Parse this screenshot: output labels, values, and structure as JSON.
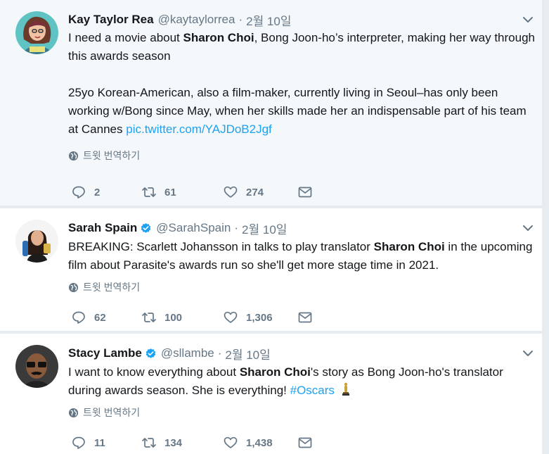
{
  "tweets": [
    {
      "name": "Kay Taylor Rea",
      "handle": "@kaytaylorrea",
      "date": "2월 10일",
      "text_parts": {
        "p1a": "I need a movie about ",
        "p1b": "Sharon Choi",
        "p1c": ", Bong Joon-ho’s interpreter, making her way through this awards season",
        "p2a": "25yo Korean-American, also a film-maker, currently living in Seoul–has only been working w/Bong since May, when her skills made her an indispensable part of his team at Cannes ",
        "p2link": "pic.twitter.com/YAJDoB2Jgf"
      },
      "translate": "트윗 번역하기",
      "replies": "2",
      "retweets": "61",
      "likes": "274"
    },
    {
      "name": "Sarah Spain",
      "handle": "@SarahSpain",
      "date": "2월 10일",
      "text_parts": {
        "a": "BREAKING: Scarlett Johansson in talks to play translator ",
        "b": "Sharon Choi",
        "c": " in the upcoming film about Parasite's awards run so she'll get more stage time in 2021."
      },
      "translate": "트윗 번역하기",
      "replies": "62",
      "retweets": "100",
      "likes": "1,306"
    },
    {
      "name": "Stacy Lambe",
      "handle": "@sllambe",
      "date": "2월 10일",
      "text_parts": {
        "a": "I want to know everything about ",
        "b": "Sharon Choi",
        "c": "'s story as Bong Joon-ho's translator during awards season. She is everything! ",
        "hashtag": "#Oscars"
      },
      "translate": "트윗 번역하기",
      "replies": "11",
      "retweets": "134",
      "likes": "1,438"
    }
  ],
  "colors": {
    "page_bg": "#e6ecf0",
    "highlight_bg": "#f5f8fa",
    "link": "#1da1f2",
    "muted": "#657786",
    "verified": "#1da1f2"
  },
  "icons": {
    "reply": "reply-icon",
    "retweet": "retweet-icon",
    "like": "heart-icon",
    "dm": "envelope-icon",
    "more": "chevron-down-icon",
    "translate": "globe-icon",
    "verified": "verified-badge-icon",
    "trophy": "oscar-statue-icon"
  }
}
